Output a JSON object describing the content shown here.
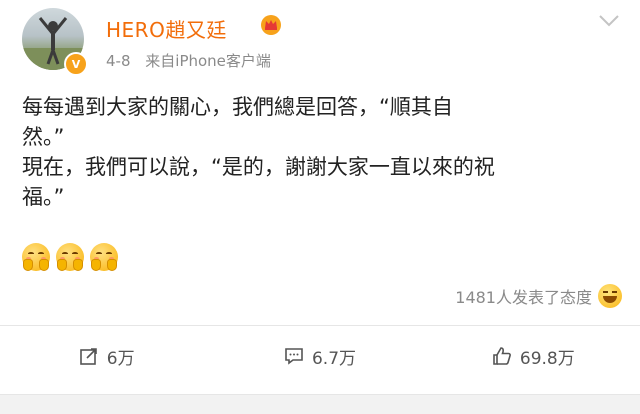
{
  "post": {
    "author": {
      "name": "HERO趙又廷",
      "verified": true
    },
    "date": "4-8",
    "source": "来自iPhone客户端",
    "lines": [
      "每每遇到大家的關心，我們總是回答，“順其自",
      "然。”",
      "現在，我們可以說，“是的，謝謝大家一直以來的祝",
      "福。”"
    ],
    "emojis": [
      "hug-emoji",
      "hug-emoji",
      "hug-emoji"
    ],
    "reaction_text": "1481人发表了态度"
  },
  "actions": {
    "repost": "6万",
    "comment": "6.7万",
    "like": "69.8万"
  },
  "colors": {
    "username": "#f26d0a",
    "meta": "#8a8a8a",
    "verified_badge": "#f7a21b"
  }
}
